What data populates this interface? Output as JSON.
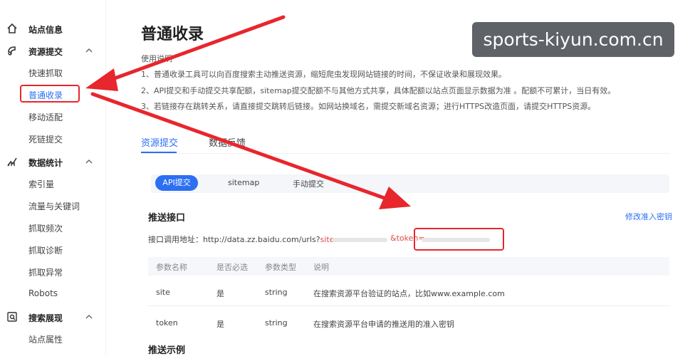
{
  "sidebar": {
    "groups": [
      {
        "label": "站点信息",
        "icon": "home-icon"
      },
      {
        "label": "资源提交",
        "icon": "submit-icon",
        "items": [
          "快速抓取",
          "普通收录",
          "移动适配",
          "死链提交"
        ]
      },
      {
        "label": "数据统计",
        "icon": "chart-icon",
        "items": [
          "索引量",
          "流量与关键词",
          "抓取频次",
          "抓取诊断",
          "抓取异常",
          "Robots"
        ]
      },
      {
        "label": "搜索展现",
        "icon": "search-display-icon",
        "items": [
          "站点属性"
        ]
      }
    ],
    "active_item": "普通收录"
  },
  "main": {
    "title": "普通收录",
    "usage_heading": "使用说明",
    "notes": [
      "1、普通收录工具可以向百度搜索主动推送资源，缩短爬虫发现网站链接的时间，不保证收录和展现效果。",
      "2、API提交和手动提交共享配额，sitemap提交配额不与其他方式共享，具体配额以站点页面显示数据为准 。配额不可累计，当日有效。",
      "3、若链接存在跳转关系，请直接提交跳转后链接。如网站换域名，需提交新域名资源；进行HTTPS改造页面，请提交HTTPS资源。"
    ],
    "tabs": [
      "资源提交",
      "数据反馈"
    ],
    "submit_methods": [
      "API提交",
      "sitemap",
      "手动提交"
    ],
    "push_section": {
      "title": "推送接口",
      "modify_link": "修改准入密钥",
      "endpoint_label": "接口调用地址：",
      "endpoint_url": "http://data.zz.baidu.com/urls?",
      "site_param": "site=",
      "token_param": "&token="
    },
    "param_table": {
      "headers": [
        "参数名称",
        "是否必选",
        "参数类型",
        "说明"
      ],
      "rows": [
        [
          "site",
          "是",
          "string",
          "在搜索资源平台验证的站点，比如www.example.com"
        ],
        [
          "token",
          "是",
          "string",
          "在搜索资源平台申请的推送用的准入密钥"
        ]
      ]
    },
    "example_title": "推送示例"
  },
  "watermark": "sports-kiyun.com.cn",
  "colors": {
    "accent": "#2b6ff3",
    "annotation_red": "#e8262d"
  }
}
